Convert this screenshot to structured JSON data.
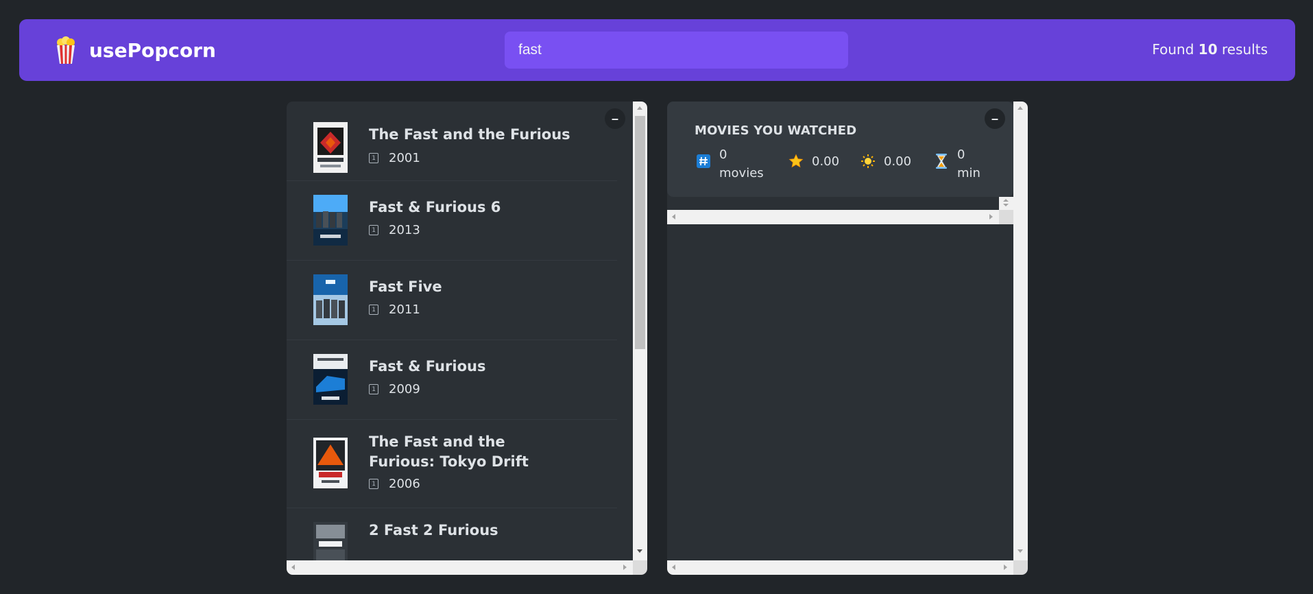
{
  "nav": {
    "logo_text": "usePopcorn",
    "search": {
      "value": "fast",
      "placeholder": "Search movies..."
    },
    "results_prefix": "Found",
    "results_count": "10",
    "results_suffix": "results"
  },
  "movies": [
    {
      "title": "The Fast and the Furious",
      "year": "2001",
      "calendar_glyph": "1"
    },
    {
      "title": "Fast & Furious 6",
      "year": "2013",
      "calendar_glyph": "1"
    },
    {
      "title": "Fast Five",
      "year": "2011",
      "calendar_glyph": "1"
    },
    {
      "title": "Fast & Furious",
      "year": "2009",
      "calendar_glyph": "1"
    },
    {
      "title": "The Fast and the Furious: Tokyo Drift",
      "year": "2006",
      "calendar_glyph": "1"
    },
    {
      "title": "2 Fast 2 Furious",
      "year": "",
      "calendar_glyph": "1"
    }
  ],
  "summary": {
    "heading": "Movies you watched",
    "movies_count": "0",
    "movies_label": "movies",
    "imdb_rating": "0.00",
    "user_rating": "0.00",
    "runtime_value": "0",
    "runtime_unit": "min"
  },
  "toggle_label": "–",
  "colors": {
    "background": "#212529",
    "nav": "#6741d9",
    "search": "#7950f2",
    "box": "#2b3035",
    "summary": "#343a40"
  }
}
